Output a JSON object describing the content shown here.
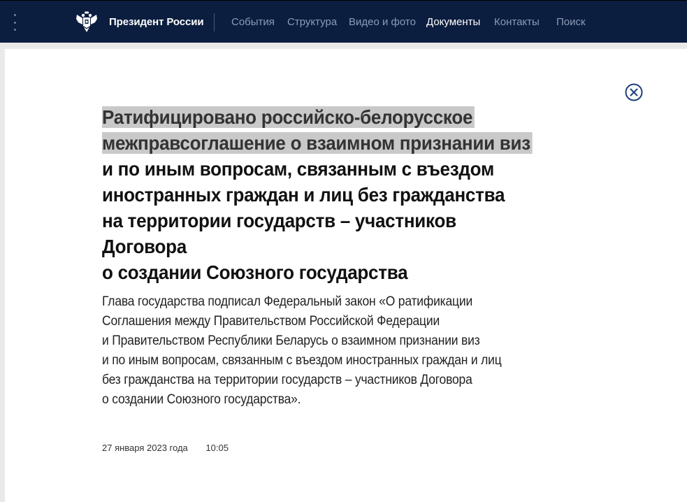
{
  "header": {
    "site_title": "Президент России",
    "nav": [
      {
        "label": "События",
        "active": false
      },
      {
        "label": "Структура",
        "active": false
      },
      {
        "label": "Видео и фото",
        "active": false
      },
      {
        "label": "Документы",
        "active": true
      },
      {
        "label": "Контакты",
        "active": false
      },
      {
        "label": "Поиск",
        "active": false
      }
    ]
  },
  "article": {
    "headline_highlighted_lines": [
      "Ратифицировано российско-белорусское",
      "межправсоглашение о взаимном признании виз"
    ],
    "headline_lines": [
      "и по иным вопросам, связанным с въездом",
      "иностранных граждан и лиц без гражданства",
      "на территории государств – участников Договора",
      "о создании Союзного государства"
    ],
    "lead_lines": [
      "Глава государства подписал Федеральный закон «О ратификации",
      "Соглашения между Правительством Российской Федерации",
      "и Правительством Республики Беларусь о взаимном признании виз",
      "и по иным вопросам, связанным с въездом иностранных граждан и лиц",
      "без гражданства на территории государств – участников Договора",
      "о создании Союзного государства»."
    ],
    "date": "27 января 2023 года",
    "time": "10:05"
  },
  "colors": {
    "header_bg": "#0b1e3f",
    "nav_text": "#8c9bb8",
    "nav_active": "#ffffff",
    "close_icon": "#1f3f7a",
    "highlight": "#c9c9c9"
  },
  "icons": {
    "menu": "vertical-dots-icon",
    "emblem": "double-headed-eagle-icon",
    "close": "close-circle-icon"
  }
}
